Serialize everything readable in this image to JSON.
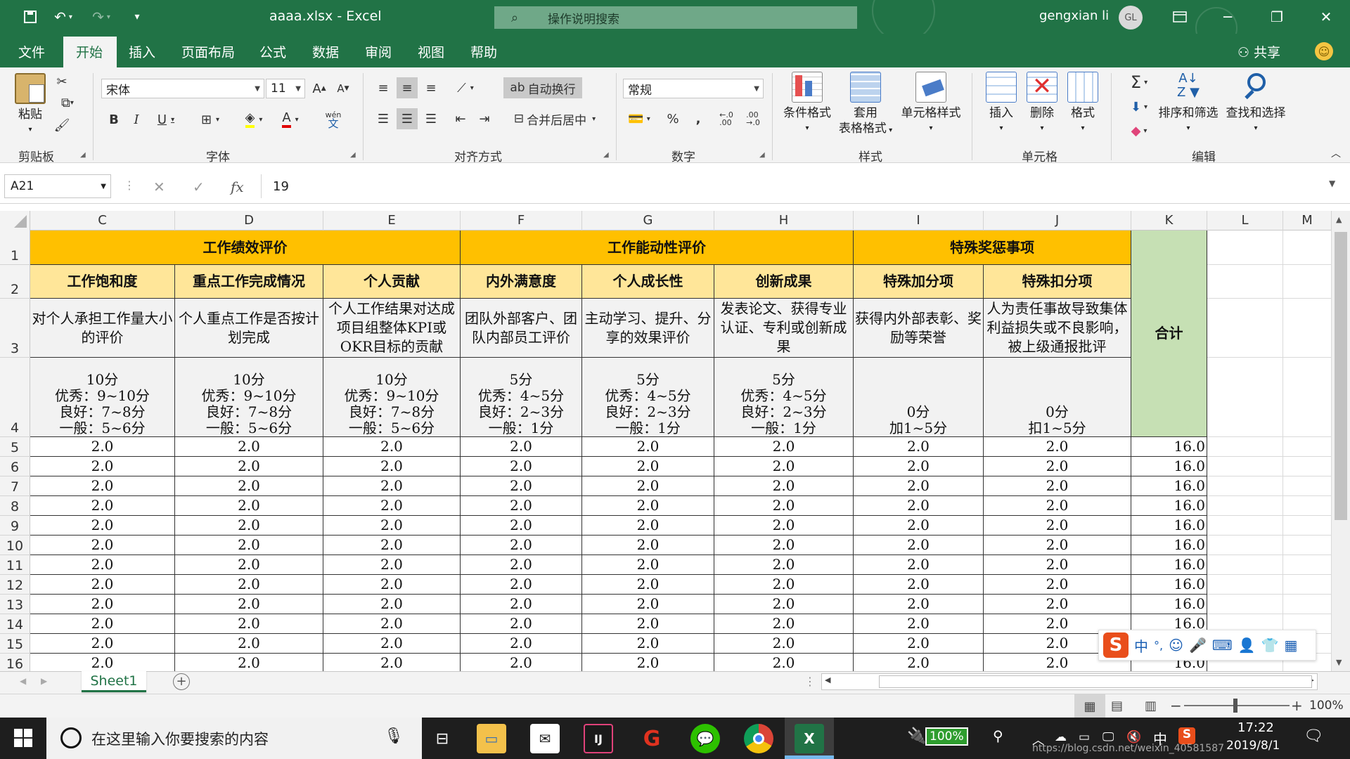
{
  "window": {
    "title": "aaaa.xlsx  -  Excel",
    "search_placeholder": "操作说明搜索",
    "user": "gengxian li",
    "avatar": "GL"
  },
  "menu": {
    "tabs": [
      "文件",
      "开始",
      "插入",
      "页面布局",
      "公式",
      "数据",
      "审阅",
      "视图",
      "帮助"
    ],
    "active": "开始",
    "share": "共享"
  },
  "ribbon": {
    "clipboard": {
      "label": "剪贴板",
      "paste": "粘贴"
    },
    "font": {
      "label": "字体",
      "name": "宋体",
      "size": "11",
      "wen": "wén"
    },
    "alignment": {
      "label": "对齐方式",
      "wrap": "自动换行",
      "merge": "合并后居中"
    },
    "number": {
      "label": "数字",
      "format": "常规"
    },
    "styles": {
      "label": "样式",
      "conditional": "条件格式",
      "table_line1": "套用",
      "table_line2": "表格格式",
      "cell_styles": "单元格样式"
    },
    "cells": {
      "label": "单元格",
      "insert": "插入",
      "delete": "删除",
      "format": "格式"
    },
    "editing": {
      "label": "编辑",
      "sort": "排序和筛选",
      "find": "查找和选择"
    }
  },
  "formula_bar": {
    "name_box": "A21",
    "value": "19",
    "fx": "fx"
  },
  "grid": {
    "columns": [
      "C",
      "D",
      "E",
      "F",
      "G",
      "H",
      "I",
      "J",
      "K",
      "L",
      "M"
    ],
    "rows": [
      "1",
      "2",
      "3",
      "4",
      "5",
      "6",
      "7",
      "8",
      "9",
      "10",
      "11",
      "12",
      "13",
      "14",
      "15",
      "16"
    ],
    "group_headers": [
      "工作绩效评价",
      "工作能动性评价",
      "特殊奖惩事项"
    ],
    "total_header": "合计",
    "sub_headers": [
      "工作饱和度",
      "重点工作完成情况",
      "个人贡献",
      "内外满意度",
      "个人成长性",
      "创新成果",
      "特殊加分项",
      "特殊扣分项"
    ],
    "descriptions": [
      "对个人承担工作量大小的评价",
      "个人重点工作是否按计划完成",
      "个人工作结果对达成项目组整体KPI或OKR目标的贡献",
      "团队外部客户、团队内部员工评价",
      "主动学习、提升、分享的效果评价",
      "发表论文、获得专业认证、专利或创新成果",
      "获得内外部表彰、奖励等荣誉",
      "人为责任事故导致集体利益损失或不良影响，被上级通报批评"
    ],
    "scoring": [
      "10分\n优秀：9~10分\n良好：7~8分\n一般：5~6分",
      "10分\n优秀：9~10分\n良好：7~8分\n一般：5~6分",
      "10分\n优秀：9~10分\n良好：7~8分\n一般：5~6分",
      "5分\n优秀：4~5分\n良好：2~3分\n一般：1分",
      "5分\n优秀：4~5分\n良好：2~3分\n一般：1分",
      "5分\n优秀：4~5分\n良好：2~3分\n一般：1分",
      "0分\n加1~5分",
      "0分\n扣1~5分"
    ],
    "cell_value": "2.0",
    "total_value": "16.0"
  },
  "sheets": {
    "tabs": [
      "Sheet1"
    ]
  },
  "status": {
    "zoom": "100%"
  },
  "taskbar": {
    "search": "在这里输入你要搜索的内容",
    "battery": "100%",
    "time": "17:22",
    "date": "2019/8/1",
    "ime_lang": "中",
    "watermark": "https://blog.csdn.net/weixin_40581587"
  },
  "ime": {
    "lang": "中",
    "punct": "°,"
  },
  "colors": {
    "excel_green": "#217346",
    "header_orange": "#ffc000",
    "header_light": "#ffe699",
    "total_green": "#c6e0b4"
  }
}
